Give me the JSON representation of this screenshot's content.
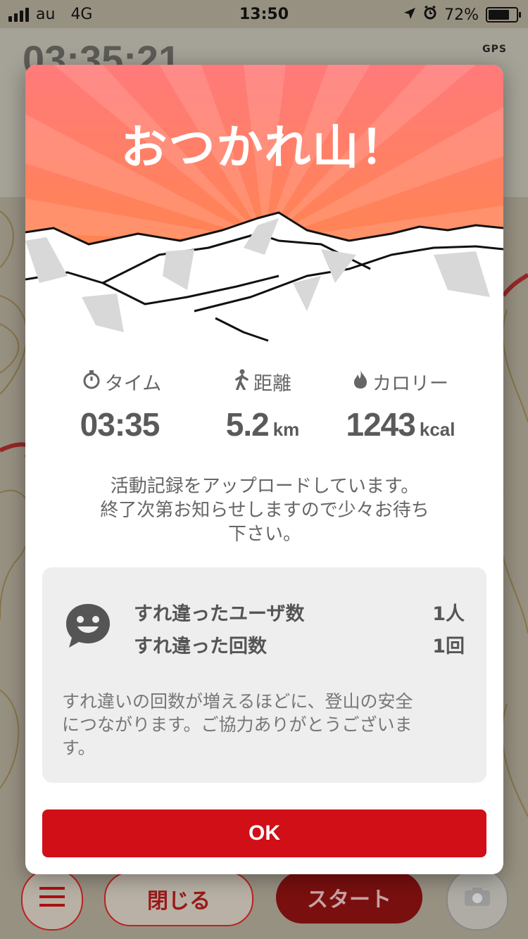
{
  "status_bar": {
    "carrier": "au",
    "network": "4G",
    "time": "13:50",
    "battery": "72%"
  },
  "background": {
    "timer_fragment": "03:35:21",
    "gps_label": "GPS",
    "route_color": "#cc1b1b"
  },
  "toolbar": {
    "close_label": "閉じる",
    "start_label": "スタート"
  },
  "modal": {
    "title": "おつかれ山！",
    "stats": [
      {
        "label": "タイム",
        "value": "03:35",
        "unit": "",
        "icon": "stopwatch-icon"
      },
      {
        "label": "距離",
        "value": "5.2",
        "unit": "km",
        "icon": "walker-icon"
      },
      {
        "label": "カロリー",
        "value": "1243",
        "unit": "kcal",
        "icon": "flame-icon"
      }
    ],
    "upload_message_lines": [
      "活動記録をアップロードしています。",
      "終了次第お知らせしますので少々お待ち",
      "下さい。"
    ],
    "encounter": {
      "users_label": "すれ違ったユーザ数",
      "users_value": "1人",
      "count_label": "すれ違った回数",
      "count_value": "1回",
      "note_lines": [
        "すれ違いの回数が増えるほどに、登山の安全",
        "につながります。ご協力ありがとうございま",
        "す。"
      ]
    },
    "ok_label": "OK"
  },
  "colors": {
    "accent_red": "#d10f16",
    "header_orange": "#ff8a4c",
    "header_pink": "#ff7a7a"
  }
}
